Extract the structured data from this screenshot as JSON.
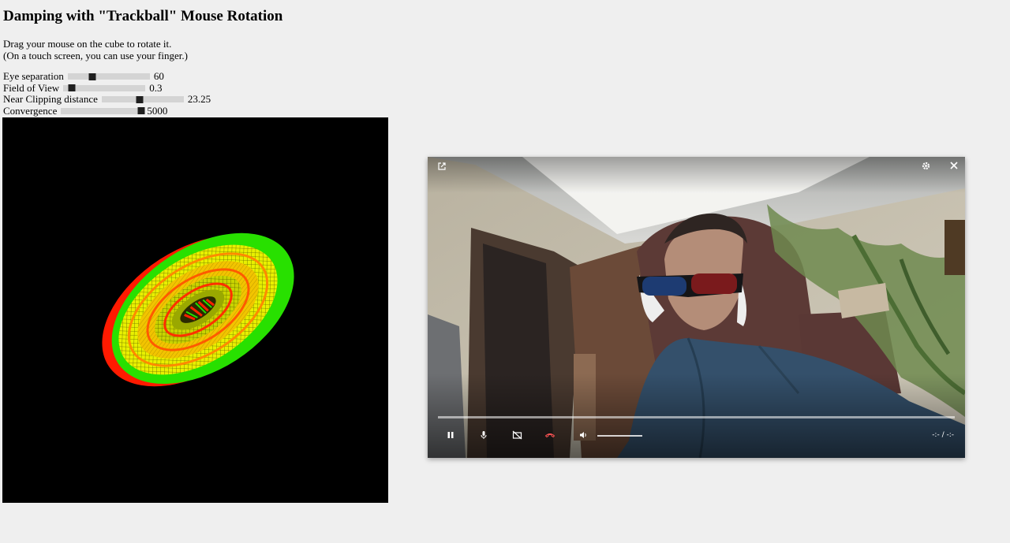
{
  "page": {
    "title": "Damping with \"Trackball\" Mouse Rotation",
    "instructions": [
      "Drag your mouse on the cube to rotate it.",
      "(On a touch screen, you can use your finger.)"
    ]
  },
  "controls": {
    "eye_separation": {
      "label": "Eye separation",
      "value": "60",
      "fraction": 0.3
    },
    "field_of_view": {
      "label": "Field of View",
      "value": "0.3",
      "fraction": 0.1
    },
    "near_clipping": {
      "label": "Near Clipping distance",
      "value": "23.25",
      "fraction": 0.46
    },
    "convergence": {
      "label": "Convergence",
      "value": "5000",
      "fraction": 0.98
    }
  },
  "scene": {
    "background": "#000000",
    "colors": [
      "#ff0000",
      "#00ff00",
      "#ffff00"
    ]
  },
  "video_player": {
    "icons": {
      "popout": "external-link-icon",
      "settings": "gear-icon",
      "close": "close-icon",
      "pause": "pause-icon",
      "mic": "microphone-icon",
      "camera_off": "camera-off-icon",
      "hangup": "hang-up-icon",
      "volume": "volume-icon"
    },
    "time": "-:- / -:-",
    "volume_fraction": 1.0
  }
}
